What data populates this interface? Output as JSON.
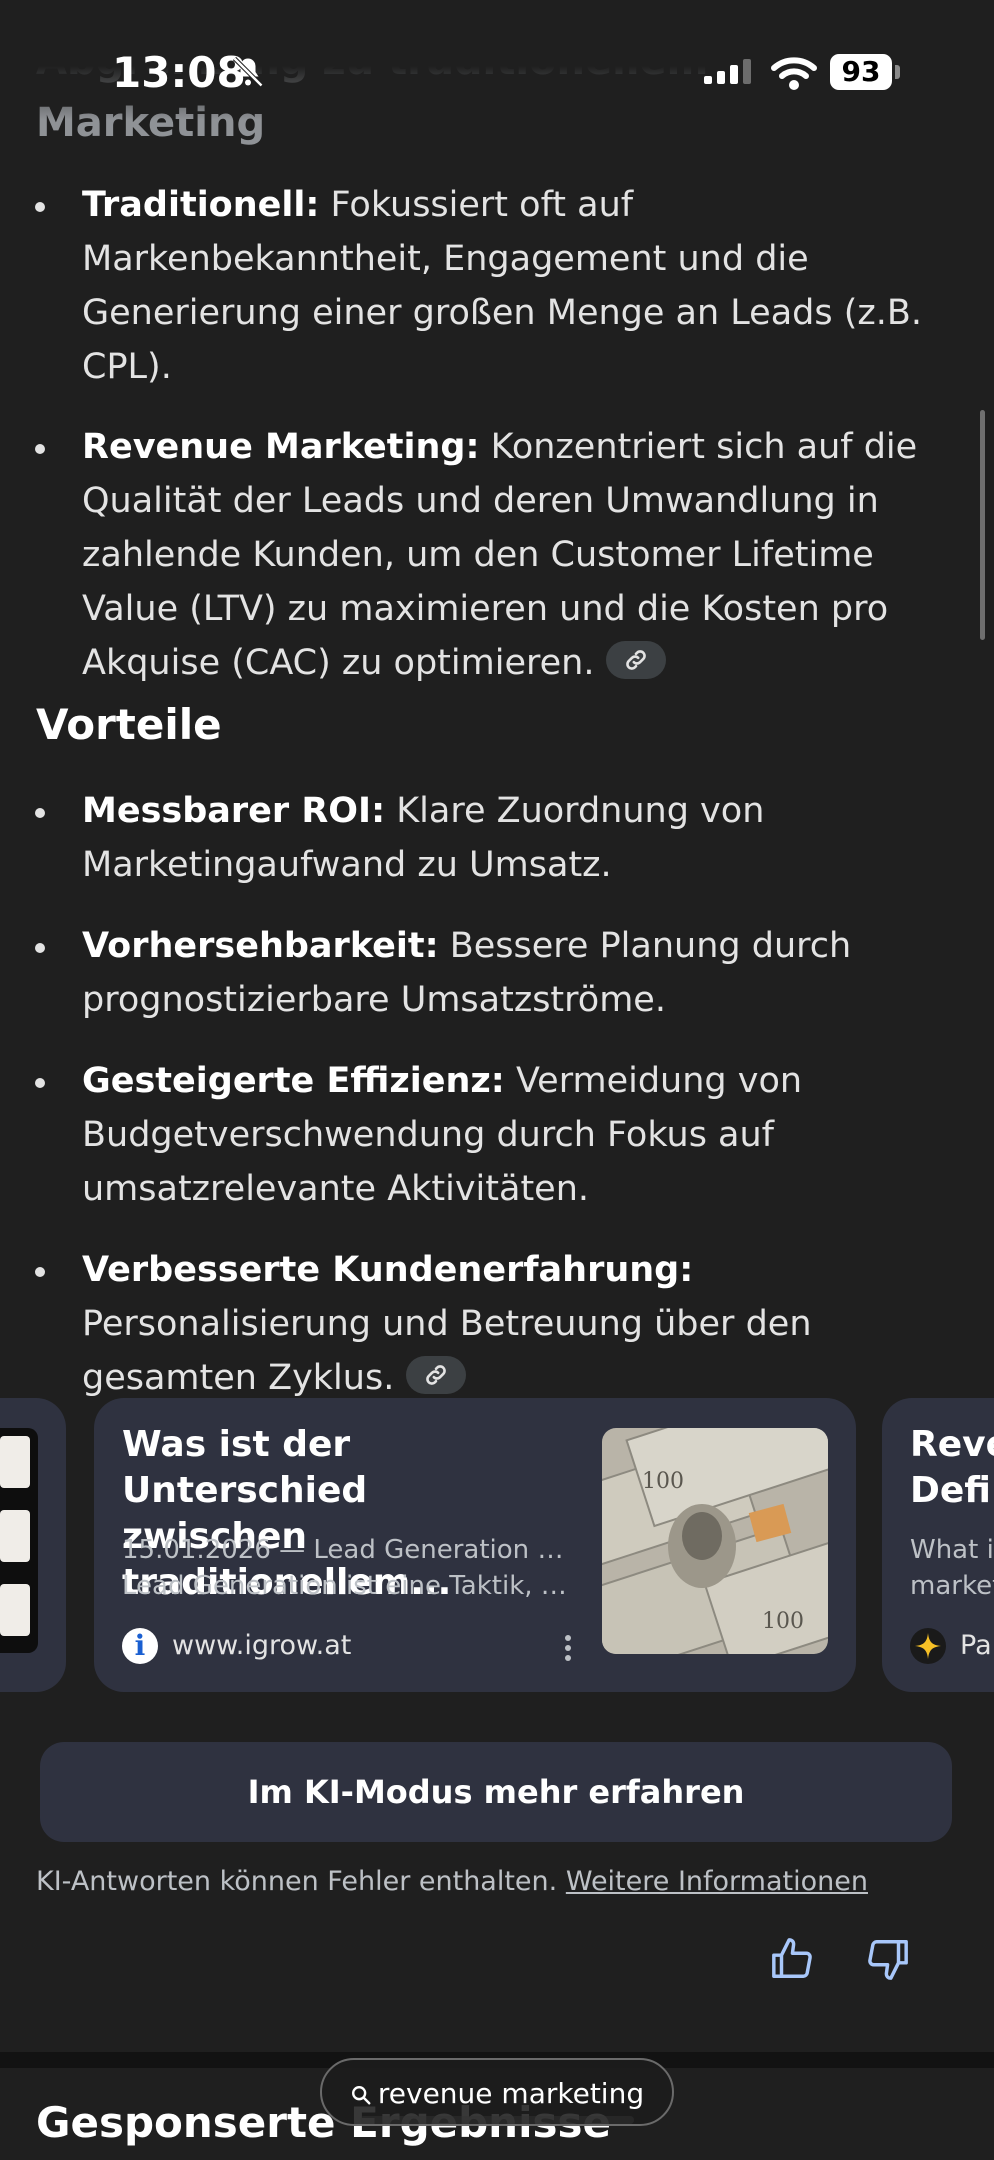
{
  "status_bar": {
    "time": "13:08",
    "battery": "93"
  },
  "sections": {
    "differentiation_title": "Abgrenzung zu traditionellem Marketing",
    "benefits_title": "Vorteile"
  },
  "differentiation": [
    {
      "label": "Traditionell:",
      "text": " Fokussiert oft auf Markenbekanntheit, Engagement und die Generierung einer großen Menge an Leads (z.B. CPL)."
    },
    {
      "label": "Revenue Marketing:",
      "text": " Konzentriert sich auf die Qualität der Leads und deren Umwandlung in zahlende Kunden, um den Customer Lifetime Value (LTV) zu maximieren und die Kosten pro Akquise (CAC) zu optimieren."
    }
  ],
  "benefits": [
    {
      "label": "Messbarer ROI:",
      "text": " Klare Zuordnung von Marketingaufwand zu Umsatz."
    },
    {
      "label": "Vorhersehbarkeit:",
      "text": " Bessere Planung durch prognostizierbare Umsatzströme."
    },
    {
      "label": "Gesteigerte Effizienz:",
      "text": " Vermeidung von Budgetverschwendung durch Fokus auf umsatzrelevante Aktivitäten."
    },
    {
      "label": "Verbesserte Kundenerfahrung:",
      "text": " Personalisierung und Betreuung über den gesamten Zyklus."
    }
  ],
  "source_cards": {
    "main": {
      "title": "Was ist der Unterschied zwischen traditionellem...",
      "snippet_line1": "15.01.2026 — Lead Generation vs. ...",
      "snippet_line2": "Lead Generation ist eine Taktik, um...",
      "site": "www.igrow.at"
    },
    "right": {
      "title_line1": "Reve",
      "title_line2": "Defin",
      "snippet_line1": "What is",
      "snippet_line2": "market",
      "site": "Pa"
    }
  },
  "ai_mode_button": "Im KI-Modus mehr erfahren",
  "disclaimer": {
    "text": "KI-Antworten können Fehler enthalten. ",
    "link": "Weitere Informationen"
  },
  "sponsored_title": "Gesponserte Ergebnisse",
  "search_pill": "revenue marketing",
  "colors": {
    "background": "#1f1f1f",
    "card": "#2f3240",
    "feedback_icon": "#a8c7fa"
  }
}
